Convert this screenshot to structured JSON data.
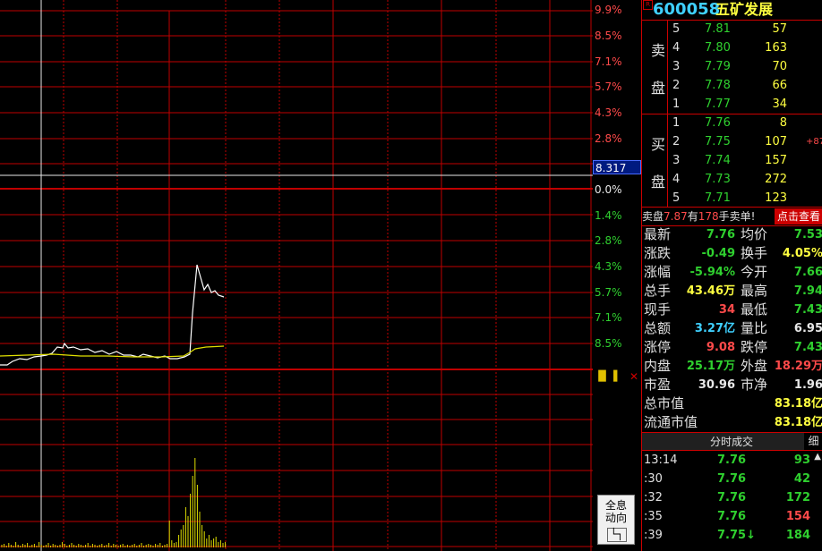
{
  "chart_pct_labels": [
    {
      "text": "9.9%",
      "cls": "up"
    },
    {
      "text": "8.5%",
      "cls": "up"
    },
    {
      "text": "7.1%",
      "cls": "up"
    },
    {
      "text": "5.7%",
      "cls": "up"
    },
    {
      "text": "4.3%",
      "cls": "up"
    },
    {
      "text": "2.8%",
      "cls": "up"
    },
    {
      "text": "0.0%",
      "cls": "zero"
    },
    {
      "text": "1.4%",
      "cls": "down"
    },
    {
      "text": "2.8%",
      "cls": "down"
    },
    {
      "text": "4.3%",
      "cls": "down"
    },
    {
      "text": "5.7%",
      "cls": "down"
    },
    {
      "text": "7.1%",
      "cls": "down"
    },
    {
      "text": "8.5%",
      "cls": "down"
    }
  ],
  "cursor_value": "8.317",
  "quanxi_button": {
    "line1": "全息",
    "line2": "动向",
    "icon": "└┐"
  },
  "title": {
    "code": "600058",
    "name": "五矿发展",
    "flag": "R"
  },
  "order_book": {
    "sell_label": [
      "卖",
      "盘"
    ],
    "buy_label": [
      "买",
      "盘"
    ],
    "sell": [
      {
        "level": "5",
        "price": "7.81",
        "volume": "57"
      },
      {
        "level": "4",
        "price": "7.80",
        "volume": "163"
      },
      {
        "level": "3",
        "price": "7.79",
        "volume": "70"
      },
      {
        "level": "2",
        "price": "7.78",
        "volume": "66"
      },
      {
        "level": "1",
        "price": "7.77",
        "volume": "34"
      }
    ],
    "buy": [
      {
        "level": "1",
        "price": "7.76",
        "volume": "8",
        "change": ""
      },
      {
        "level": "2",
        "price": "7.75",
        "volume": "107",
        "change": "+87"
      },
      {
        "level": "3",
        "price": "7.74",
        "volume": "157",
        "change": ""
      },
      {
        "level": "4",
        "price": "7.73",
        "volume": "272",
        "change": ""
      },
      {
        "level": "5",
        "price": "7.71",
        "volume": "123",
        "change": ""
      }
    ]
  },
  "notice": {
    "prefix": "卖盘",
    "price": "7.87",
    "mid": "有",
    "qty": "178",
    "suffix": "手卖单!",
    "button": "点击查看"
  },
  "stats": [
    {
      "k1": "最新",
      "v1": "7.76",
      "c1": "green",
      "k2": "均价",
      "v2": "7.53",
      "c2": "green"
    },
    {
      "k1": "涨跌",
      "v1": "-0.49",
      "c1": "green",
      "k2": "换手",
      "v2": "4.05%",
      "c2": "yellow"
    },
    {
      "k1": "涨幅",
      "v1": "-5.94%",
      "c1": "green",
      "k2": "今开",
      "v2": "7.66",
      "c2": "green"
    },
    {
      "k1": "总手",
      "v1": "43.46万",
      "c1": "yellow",
      "k2": "最高",
      "v2": "7.94",
      "c2": "green"
    },
    {
      "k1": "现手",
      "v1": "34",
      "c1": "red",
      "k2": "最低",
      "v2": "7.43",
      "c2": "green"
    },
    {
      "k1": "总额",
      "v1": "3.27亿",
      "c1": "cyan",
      "k2": "量比",
      "v2": "6.95",
      "c2": "white"
    },
    {
      "k1": "涨停",
      "v1": "9.08",
      "c1": "red",
      "k2": "跌停",
      "v2": "7.43",
      "c2": "green"
    },
    {
      "k1": "内盘",
      "v1": "25.17万",
      "c1": "green",
      "k2": "外盘",
      "v2": "18.29万",
      "c2": "red"
    },
    {
      "k1": "市盈",
      "v1": "30.96",
      "c1": "white",
      "k2": "市净",
      "v2": "1.96",
      "c2": "white"
    },
    {
      "k1": "总市值",
      "v1": "",
      "c1": "white",
      "k2": "",
      "v2": "83.18亿",
      "c2": "yellow"
    },
    {
      "k1": "流通市值",
      "v1": "",
      "c1": "white",
      "k2": "",
      "v2": "83.18亿",
      "c2": "yellow"
    }
  ],
  "tabs": {
    "left": "分时成交",
    "right": "细"
  },
  "trades": [
    {
      "time": "13:14",
      "price": "7.76",
      "volume": "93",
      "vcls": "green",
      "arrow": ""
    },
    {
      "time": ":30",
      "price": "7.76",
      "volume": "42",
      "vcls": "green",
      "arrow": ""
    },
    {
      "time": ":32",
      "price": "7.76",
      "volume": "172",
      "vcls": "green",
      "arrow": ""
    },
    {
      "time": ":35",
      "price": "7.76",
      "volume": "154",
      "vcls": "red",
      "arrow": ""
    },
    {
      "time": ":39",
      "price": "7.75",
      "volume": "184",
      "vcls": "green",
      "arrow": "↓"
    }
  ],
  "colors": {
    "grid": "#c00000",
    "price_line": "#ffffff",
    "avg_line": "#e0e000",
    "volume_bar": "#e0e000"
  }
}
